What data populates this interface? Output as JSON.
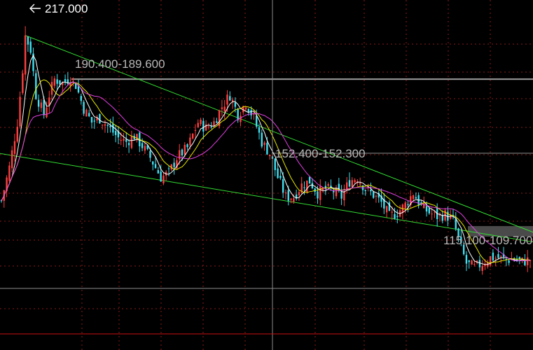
{
  "chart_data": {
    "type": "candlestick",
    "title": "",
    "xlabel": "",
    "ylabel": "",
    "ylim": [
      70,
      225
    ],
    "grid": true,
    "annotations": {
      "high_marker": "217.000",
      "price_levels": [
        "190.400-189.600",
        "152.400-152.300",
        "115.100-109.700"
      ]
    },
    "price_levels": [
      {
        "label": "190.400-189.600",
        "low": 189.6,
        "high": 190.4
      },
      {
        "label": "152.400-152.300",
        "low": 152.3,
        "high": 152.4
      },
      {
        "label": "115.100-109.700",
        "low": 109.7,
        "high": 115.1
      }
    ],
    "high_value": 217.0,
    "bottom_reference_price": 75.0,
    "trend_lines": [
      {
        "name": "upper",
        "points": [
          [
            0,
            217.0
          ],
          [
            200,
            112.0
          ]
        ]
      },
      {
        "name": "lower",
        "points": [
          [
            0,
            152.0
          ],
          [
            200,
            107.0
          ]
        ]
      }
    ],
    "ma_colors": {
      "ma_short": "#ffffff",
      "ma_mid": "#e8e800",
      "ma_long": "#e040e0"
    },
    "colors": {
      "up": "#ff4040",
      "down": "#40e0f0",
      "grid": "#8b1a1a",
      "trend": "#33dd33",
      "bottom_line": "#cc1111"
    },
    "closes_anchor": [
      [
        0,
        128
      ],
      [
        3,
        145
      ],
      [
        6,
        168
      ],
      [
        8,
        195
      ],
      [
        9,
        212
      ],
      [
        11,
        205
      ],
      [
        13,
        182
      ],
      [
        16,
        172
      ],
      [
        18,
        182
      ],
      [
        20,
        190
      ],
      [
        23,
        188
      ],
      [
        26,
        191
      ],
      [
        28,
        187
      ],
      [
        31,
        175
      ],
      [
        34,
        168
      ],
      [
        37,
        170
      ],
      [
        40,
        166
      ],
      [
        44,
        160
      ],
      [
        47,
        158
      ],
      [
        50,
        161
      ],
      [
        53,
        156
      ],
      [
        56,
        150
      ],
      [
        60,
        140
      ],
      [
        63,
        142
      ],
      [
        66,
        150
      ],
      [
        70,
        155
      ],
      [
        74,
        168
      ],
      [
        77,
        165
      ],
      [
        80,
        168
      ],
      [
        83,
        176
      ],
      [
        86,
        182
      ],
      [
        89,
        172
      ],
      [
        92,
        178
      ],
      [
        95,
        170
      ],
      [
        98,
        158
      ],
      [
        101,
        152
      ],
      [
        104,
        140
      ],
      [
        107,
        130
      ],
      [
        110,
        130
      ],
      [
        113,
        136
      ],
      [
        116,
        138
      ],
      [
        119,
        132
      ],
      [
        122,
        134
      ],
      [
        125,
        133
      ],
      [
        128,
        130
      ],
      [
        131,
        138
      ],
      [
        134,
        140
      ],
      [
        137,
        134
      ],
      [
        140,
        131
      ],
      [
        143,
        127
      ],
      [
        146,
        120
      ],
      [
        149,
        122
      ],
      [
        152,
        126
      ],
      [
        155,
        132
      ],
      [
        158,
        125
      ],
      [
        161,
        122
      ],
      [
        164,
        120
      ],
      [
        167,
        121
      ],
      [
        170,
        118
      ],
      [
        173,
        104
      ],
      [
        175,
        96
      ],
      [
        178,
        94
      ],
      [
        181,
        96
      ],
      [
        184,
        99
      ],
      [
        187,
        99
      ],
      [
        190,
        98
      ],
      [
        193,
        98
      ],
      [
        196,
        97
      ],
      [
        199,
        98
      ]
    ]
  }
}
